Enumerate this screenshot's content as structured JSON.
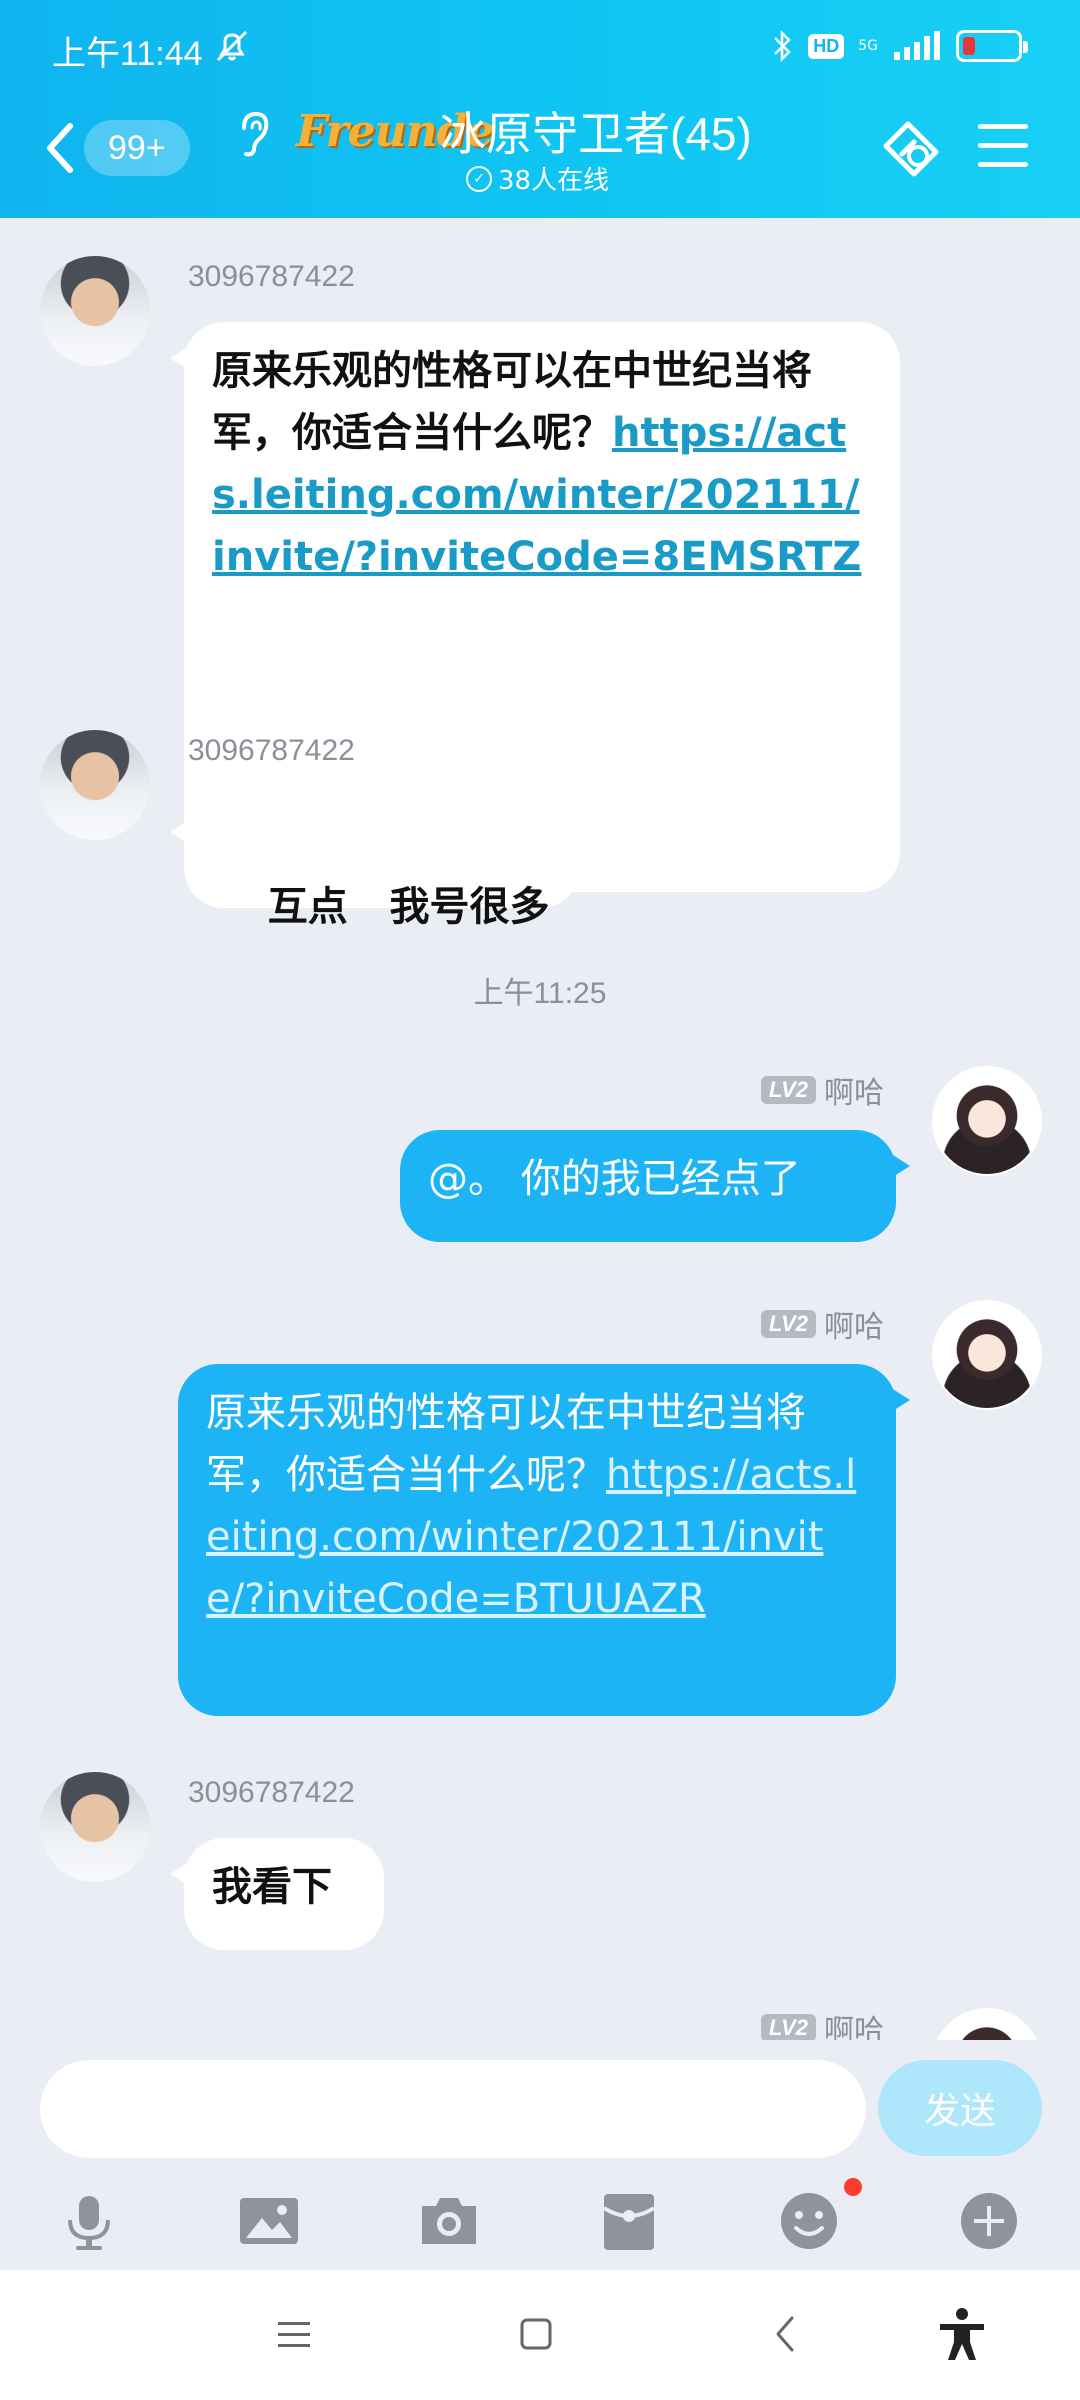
{
  "status_bar": {
    "time": "上午11:44",
    "hd": "HD",
    "network": "5G"
  },
  "header": {
    "unread_count": "99+",
    "brand_text": "Freunde",
    "group_title": "冰原守卫者(45)",
    "online_text": "38人在线"
  },
  "messages": [
    {
      "sender": "3096787422",
      "text": "原来乐观的性格可以在中世纪当将军，你适合当什么呢？",
      "link": "https://acts.leiting.com/winter/202111/invite/?inviteCode=8EMSRTZ"
    },
    {
      "sender": "3096787422",
      "text": "互点   我号很多"
    },
    {
      "time_separator": "上午11:25"
    },
    {
      "sender": "啊哈",
      "level": "LV2",
      "text": "@。 你的我已经点了"
    },
    {
      "sender": "啊哈",
      "level": "LV2",
      "text": "原来乐观的性格可以在中世纪当将军，你适合当什么呢？",
      "link": "https://acts.leiting.com/winter/202111/invite/?inviteCode=BTUUAZR"
    },
    {
      "sender": "3096787422",
      "text": "我看下"
    },
    {
      "sender": "啊哈",
      "level": "LV2"
    }
  ],
  "input": {
    "placeholder": "",
    "send_label": "发送"
  },
  "toolbar_icons": [
    "microphone-icon",
    "image-icon",
    "camera-icon",
    "red-packet-icon",
    "emoji-icon",
    "plus-icon"
  ],
  "nav_icons": [
    "menu-icon",
    "home-icon",
    "back-icon",
    "accessibility-icon"
  ],
  "colors": {
    "header_gradient_start": "#10b4ef",
    "outgoing_bubble": "#1db4f5",
    "send_button": "#aee6fb",
    "background": "#eaedf4"
  }
}
